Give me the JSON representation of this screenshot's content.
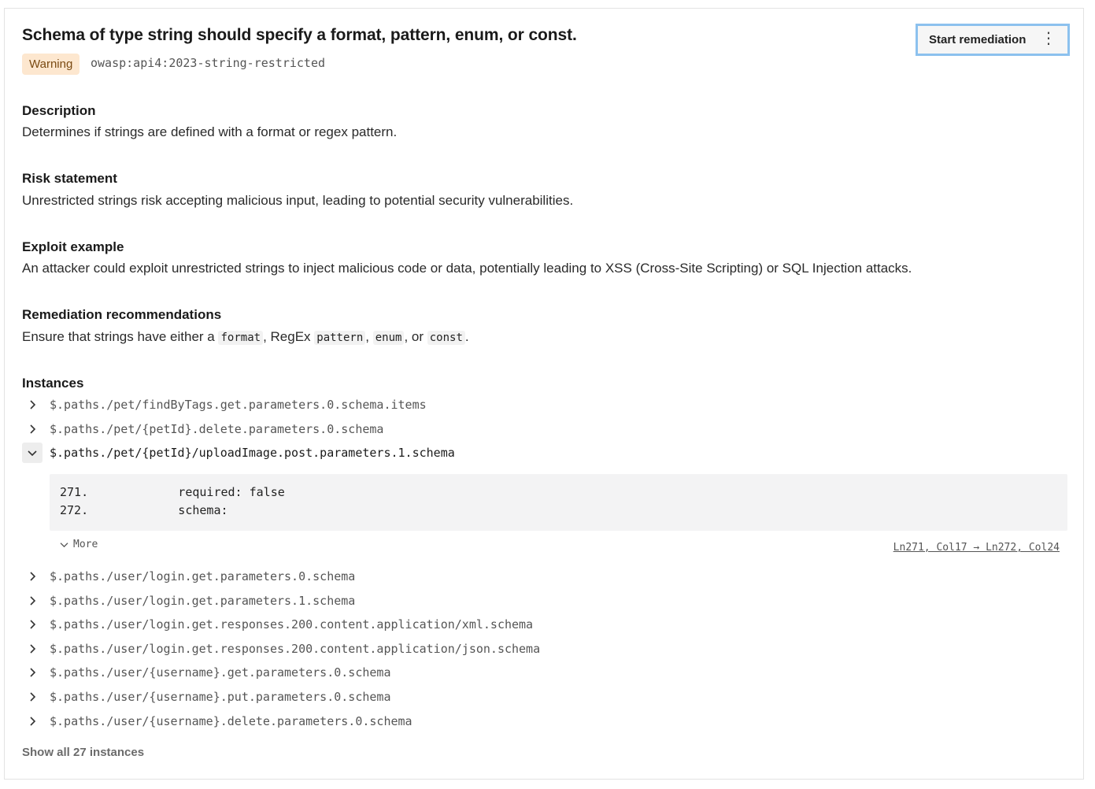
{
  "finding": {
    "title": "Schema of type string should specify a format, pattern, enum, or const.",
    "severity": "Warning",
    "rule_id": "owasp:api4:2023-string-restricted",
    "action_label": "Start remediation",
    "action_menu_icon": "vertical-ellipsis-icon"
  },
  "sections": {
    "description": {
      "heading": "Description",
      "text": "Determines if strings are defined with a format or regex pattern."
    },
    "risk": {
      "heading": "Risk statement",
      "text": "Unrestricted strings risk accepting malicious input, leading to potential security vulnerabilities."
    },
    "exploit": {
      "heading": "Exploit example",
      "text": "An attacker could exploit unrestricted strings to inject malicious code or data, potentially leading to XSS (Cross-Site Scripting) or SQL Injection attacks."
    },
    "remediation": {
      "heading": "Remediation recommendations",
      "prefix": "Ensure that strings have either a ",
      "code1": "format",
      "mid1": ", RegEx ",
      "code2": "pattern",
      "mid2": ", ",
      "code3": "enum",
      "mid3": ", or ",
      "code4": "const",
      "suffix": "."
    }
  },
  "instances": {
    "heading": "Instances",
    "items": [
      {
        "path": "$.paths./pet/findByTags.get.parameters.0.schema.items"
      },
      {
        "path": "$.paths./pet/{petId}.delete.parameters.0.schema"
      },
      {
        "path": "$.paths./pet/{petId}/uploadImage.post.parameters.1.schema"
      },
      {
        "path": "$.paths./user/login.get.parameters.0.schema"
      },
      {
        "path": "$.paths./user/login.get.parameters.1.schema"
      },
      {
        "path": "$.paths./user/login.get.responses.200.content.application/xml.schema"
      },
      {
        "path": "$.paths./user/login.get.responses.200.content.application/json.schema"
      },
      {
        "path": "$.paths./user/{username}.get.parameters.0.schema"
      },
      {
        "path": "$.paths./user/{username}.put.parameters.0.schema"
      },
      {
        "path": "$.paths./user/{username}.delete.parameters.0.schema"
      }
    ],
    "expanded_code": {
      "lines": [
        {
          "num": "271.",
          "text": "          required: false"
        },
        {
          "num": "272.",
          "text": "          schema:"
        }
      ],
      "more_label": "More",
      "location": "Ln271, Col17 → Ln272, Col24"
    },
    "show_all_label": "Show all 27 instances"
  },
  "colors": {
    "warning_bg": "#fde7cf",
    "warning_text": "#7a4a12",
    "focus_ring": "#8cc1ee",
    "code_bg": "#f3f3f4"
  }
}
